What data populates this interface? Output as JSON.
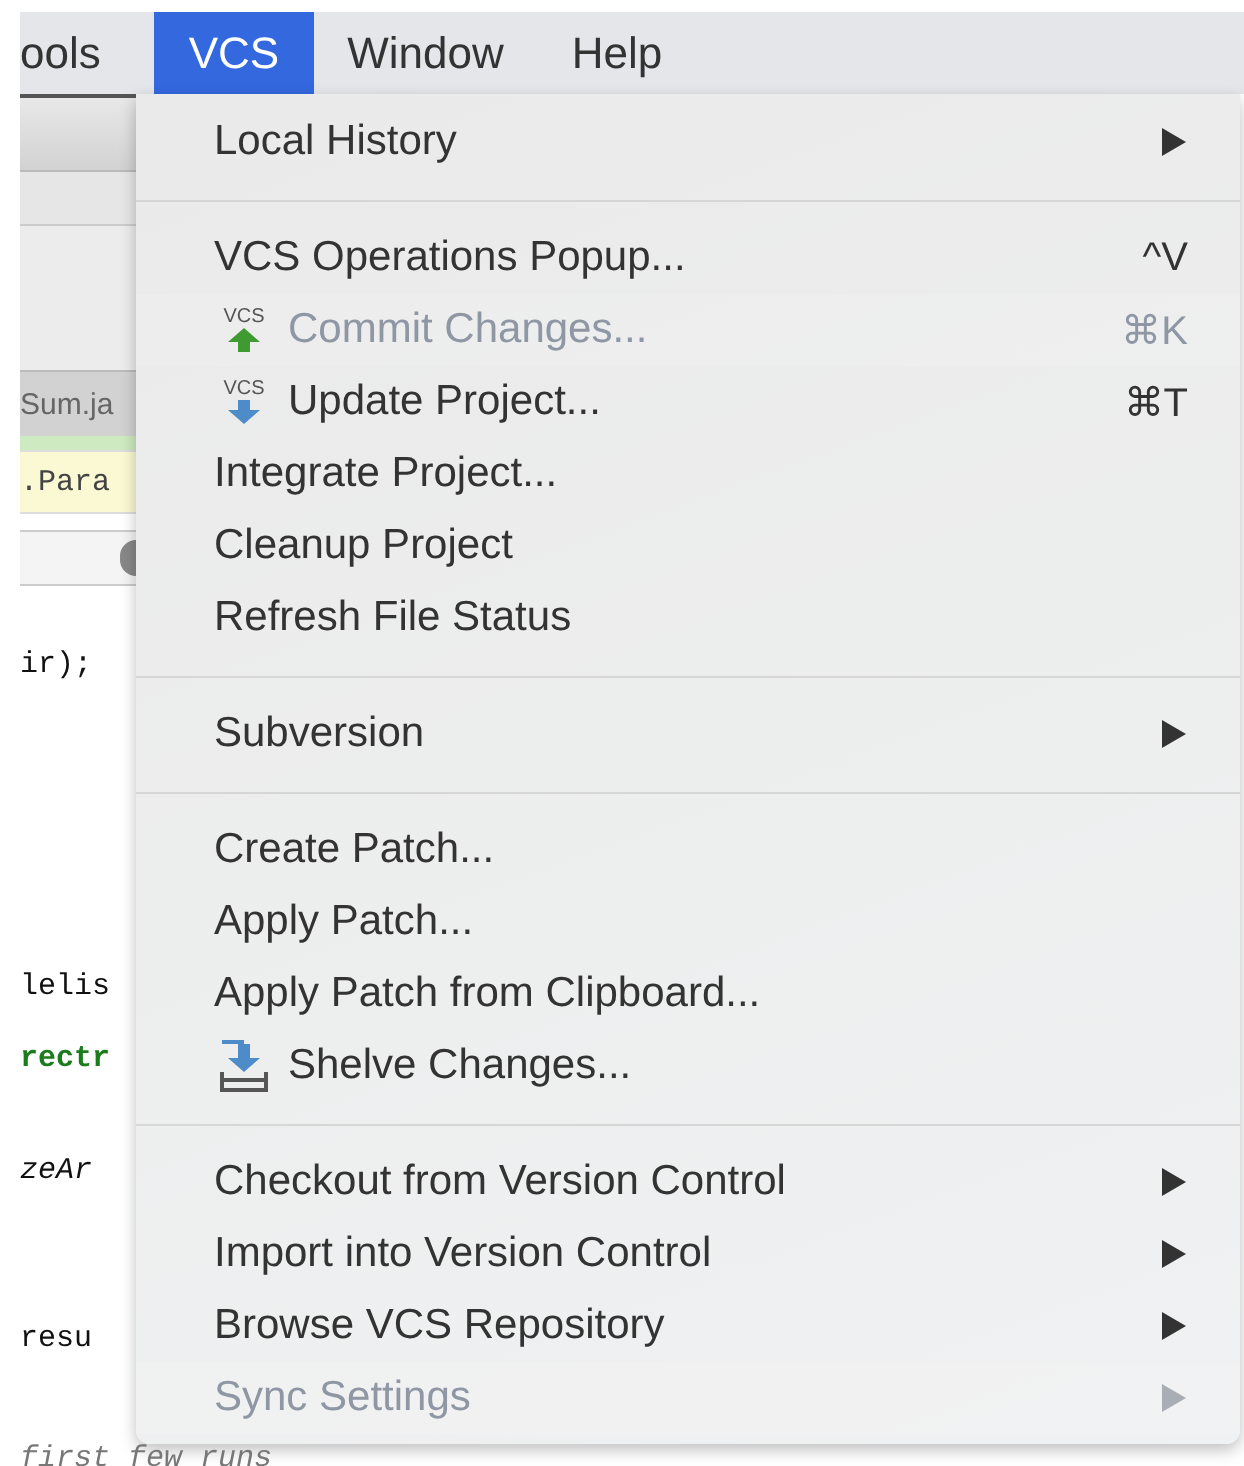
{
  "menubar": [
    {
      "label": "ools",
      "selected": false
    },
    {
      "label": "VCS",
      "selected": true
    },
    {
      "label": "Window",
      "selected": false
    },
    {
      "label": "Help",
      "selected": false
    }
  ],
  "background": {
    "tab": "Sum.ja",
    "breadcrumb": ".Para",
    "code_lines": [
      {
        "text": "ir);",
        "kind": "plain"
      },
      {
        "text": "lelis",
        "kind": "plain"
      },
      {
        "text": "rectr",
        "kind": "keyword"
      },
      {
        "text": "zeAr",
        "kind": "italic"
      },
      {
        "text": "resu",
        "kind": "plain"
      }
    ],
    "footer_line": "first few runs"
  },
  "menu": {
    "sections": [
      {
        "items": [
          {
            "label": "Local History",
            "submenu": true,
            "disabled": false,
            "kind": "plain"
          }
        ]
      },
      {
        "items": [
          {
            "label": "VCS Operations Popup...",
            "shortcut": "^V",
            "submenu": false,
            "disabled": false,
            "kind": "plain"
          },
          {
            "label": "Commit Changes...",
            "shortcut": "⌘K",
            "submenu": false,
            "disabled": true,
            "kind": "commit",
            "icon_text": "VCS"
          },
          {
            "label": "Update Project...",
            "shortcut": "⌘T",
            "submenu": false,
            "disabled": false,
            "kind": "update",
            "icon_text": "VCS"
          },
          {
            "label": "Integrate Project...",
            "submenu": false,
            "disabled": false,
            "kind": "plain"
          },
          {
            "label": "Cleanup Project",
            "submenu": false,
            "disabled": false,
            "kind": "plain"
          },
          {
            "label": "Refresh File Status",
            "submenu": false,
            "disabled": false,
            "kind": "plain"
          }
        ]
      },
      {
        "items": [
          {
            "label": "Subversion",
            "submenu": true,
            "disabled": false,
            "kind": "plain"
          }
        ]
      },
      {
        "items": [
          {
            "label": "Create Patch...",
            "submenu": false,
            "disabled": false,
            "kind": "plain"
          },
          {
            "label": "Apply Patch...",
            "submenu": false,
            "disabled": false,
            "kind": "plain"
          },
          {
            "label": "Apply Patch from Clipboard...",
            "submenu": false,
            "disabled": false,
            "kind": "plain"
          },
          {
            "label": "Shelve Changes...",
            "submenu": false,
            "disabled": false,
            "kind": "shelve"
          }
        ]
      },
      {
        "items": [
          {
            "label": "Checkout from Version Control",
            "submenu": true,
            "disabled": false,
            "kind": "plain"
          },
          {
            "label": "Import into Version Control",
            "submenu": true,
            "disabled": false,
            "kind": "plain"
          },
          {
            "label": "Browse VCS Repository",
            "submenu": true,
            "disabled": false,
            "kind": "plain"
          },
          {
            "label": "Sync Settings",
            "submenu": true,
            "disabled": true,
            "kind": "plain"
          }
        ]
      }
    ]
  }
}
